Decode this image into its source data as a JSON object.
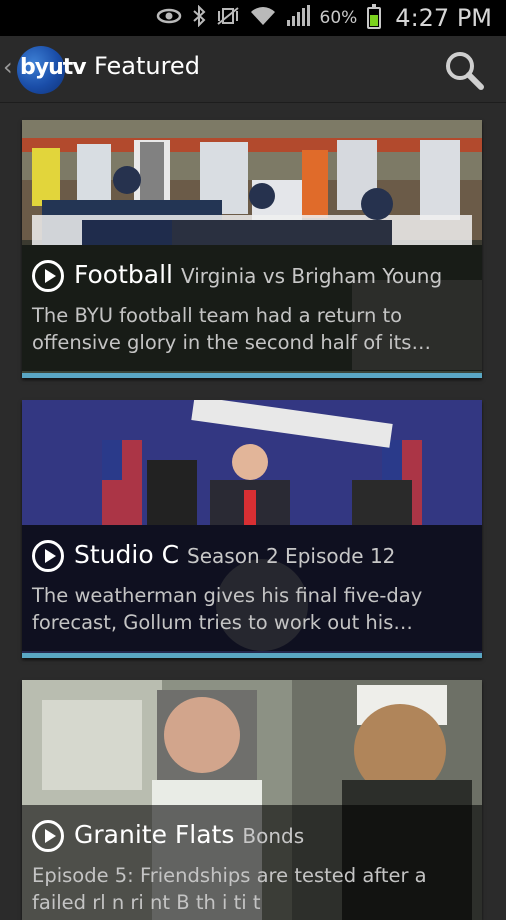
{
  "status_bar": {
    "battery_percent": "60%",
    "battery_level": 0.6,
    "time": "4:27 PM",
    "icons": [
      "eye-icon",
      "bluetooth-icon",
      "vibrate-icon",
      "wifi-icon",
      "signal-icon",
      "battery-icon"
    ]
  },
  "action_bar": {
    "logo_text": "byutv",
    "title": "Featured",
    "search_icon": "search-icon"
  },
  "cards": [
    {
      "show": "Football",
      "episode": "Virginia vs Brigham Young",
      "description": "The BYU football team had a return to offensive glory in the second half of its…"
    },
    {
      "show": "Studio C",
      "episode": "Season 2 Episode 12",
      "description": "The weatherman gives his final five-day forecast, Gollum tries to work out his…"
    },
    {
      "show": "Granite Flats",
      "episode": "Bonds",
      "description": "Episode 5: Friendships are tested after a failed rl      n     ri nt  B th i   ti t"
    }
  ],
  "colors": {
    "accent": "#5aa7c4",
    "background": "#2b2b2b",
    "logo": "#1a4da8",
    "battery": "#7bd21e"
  }
}
